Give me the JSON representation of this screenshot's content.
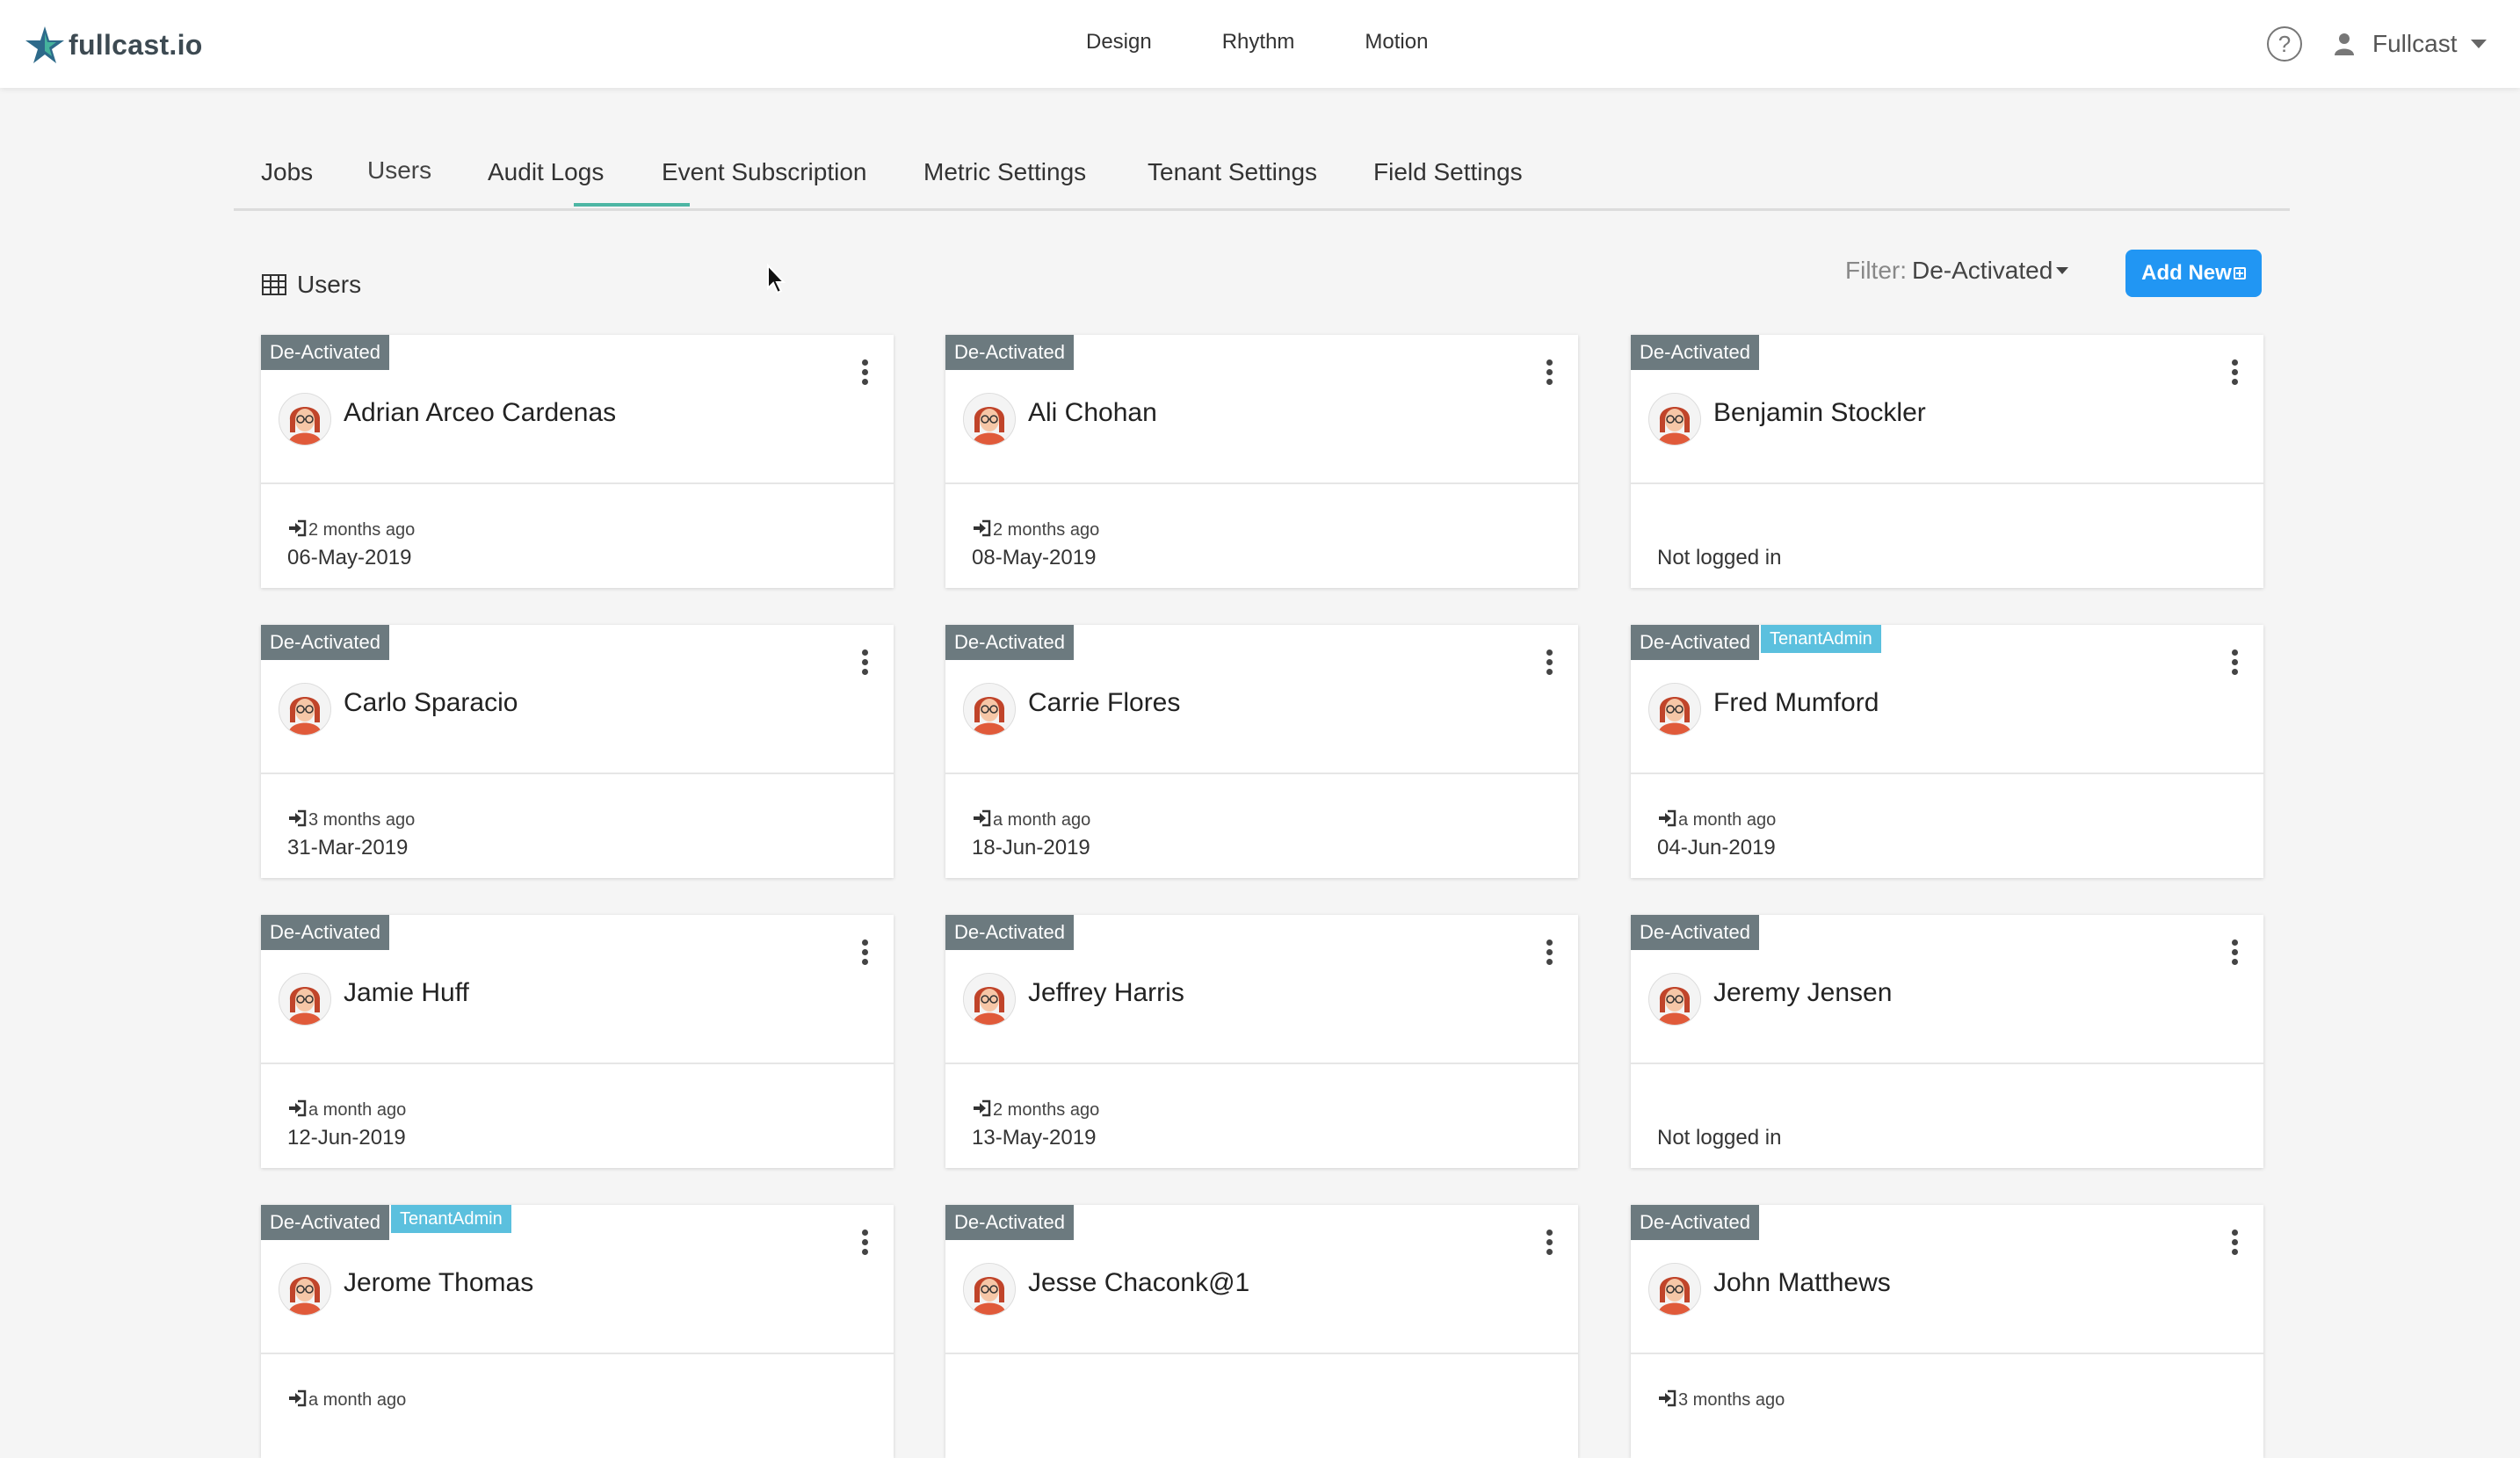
{
  "brand": {
    "name": "fullcast.io"
  },
  "top_nav": [
    "Design",
    "Rhythm",
    "Motion"
  ],
  "help": {
    "symbol": "?"
  },
  "user_menu": {
    "name": "Fullcast"
  },
  "tabs": [
    "Jobs",
    "Users",
    "Audit Logs",
    "Event Subscription",
    "Metric Settings",
    "Tenant Settings",
    "Field Settings"
  ],
  "active_tab": "Users",
  "section": {
    "title": "Users"
  },
  "filter": {
    "label": "Filter:",
    "value": "De-Activated"
  },
  "add_button": {
    "label": "Add New"
  },
  "colors": {
    "accent": "#4db6a4",
    "primary": "#2196f3",
    "badge_deactivated": "#6c7a7f",
    "badge_tenant": "#5bc0de"
  },
  "cards": [
    {
      "status": "De-Activated",
      "role": "",
      "name": "Adrian Arceo Cardenas",
      "last_login_ago": "2 months ago",
      "last_login_date": "06-May-2019",
      "not_logged": ""
    },
    {
      "status": "De-Activated",
      "role": "",
      "name": "Ali Chohan",
      "last_login_ago": "2 months ago",
      "last_login_date": "08-May-2019",
      "not_logged": ""
    },
    {
      "status": "De-Activated",
      "role": "",
      "name": "Benjamin Stockler",
      "last_login_ago": "",
      "last_login_date": "",
      "not_logged": "Not logged in"
    },
    {
      "status": "De-Activated",
      "role": "",
      "name": "Carlo Sparacio",
      "last_login_ago": "3 months ago",
      "last_login_date": "31-Mar-2019",
      "not_logged": ""
    },
    {
      "status": "De-Activated",
      "role": "",
      "name": "Carrie Flores",
      "last_login_ago": "a month ago",
      "last_login_date": "18-Jun-2019",
      "not_logged": ""
    },
    {
      "status": "De-Activated",
      "role": "TenantAdmin",
      "name": "Fred Mumford",
      "last_login_ago": "a month ago",
      "last_login_date": "04-Jun-2019",
      "not_logged": ""
    },
    {
      "status": "De-Activated",
      "role": "",
      "name": "Jamie Huff",
      "last_login_ago": "a month ago",
      "last_login_date": "12-Jun-2019",
      "not_logged": ""
    },
    {
      "status": "De-Activated",
      "role": "",
      "name": "Jeffrey Harris",
      "last_login_ago": "2 months ago",
      "last_login_date": "13-May-2019",
      "not_logged": ""
    },
    {
      "status": "De-Activated",
      "role": "",
      "name": "Jeremy Jensen",
      "last_login_ago": "",
      "last_login_date": "",
      "not_logged": "Not logged in"
    },
    {
      "status": "De-Activated",
      "role": "TenantAdmin",
      "name": "Jerome Thomas",
      "last_login_ago": "a month ago",
      "last_login_date": "",
      "not_logged": ""
    },
    {
      "status": "De-Activated",
      "role": "",
      "name": "Jesse Chaconk@1",
      "last_login_ago": "",
      "last_login_date": "",
      "not_logged": ""
    },
    {
      "status": "De-Activated",
      "role": "",
      "name": "John Matthews",
      "last_login_ago": "3 months ago",
      "last_login_date": "",
      "not_logged": ""
    }
  ]
}
